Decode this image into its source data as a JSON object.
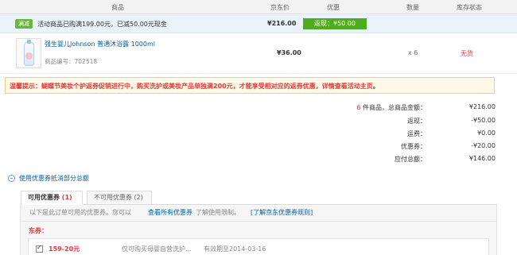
{
  "table_header": {
    "product": "商品",
    "price": "京东价",
    "discount": "优惠",
    "quantity": "数量",
    "stock": "库存状态"
  },
  "promo": {
    "tag": "满减",
    "text": "活动商品已购满199.00元，已减50.00元现金",
    "price": "¥216.00",
    "rebate": "返现：¥50.00"
  },
  "item": {
    "image_icon": "lotion-bottle-icon",
    "name": "强生婴儿Johnson 普通沐浴露 1000ml",
    "code": "商品编号：702518",
    "price": "¥36.00",
    "quantity": "x 6",
    "stock": "无货"
  },
  "warning": {
    "text": "温馨提示：蝴蝶节美妆个护返券促销进行中，购买洗护或美妆产品单独满200元，才能享受相对应的返券优惠，详情查看活动主页。"
  },
  "summary": {
    "count": "6",
    "count_suffix": "件商品，总商品金额：",
    "total_value": "¥216.00",
    "rebate_label": "返现：",
    "rebate_value": "-¥50.00",
    "shipping_label": "运费：",
    "shipping_value": "¥0.00",
    "coupon_label": "优惠券：",
    "coupon_value": "-¥20.00",
    "payable_label": "应付总额：",
    "payable_value": "¥146.00"
  },
  "coupon_section": {
    "toggle_label": "使用优惠券抵消部分总额",
    "tabs": [
      {
        "label": "可用优惠券",
        "count": "1"
      },
      {
        "label": "不可用优惠券",
        "count": "2"
      }
    ],
    "info": "以下是此订单可用的优惠券。您可以",
    "view_all_link": "查看所有优惠券",
    "view_all_suffix": "了解使用限制。",
    "rules_link": "[了解京东优惠券规则]",
    "dong_label": "东券：",
    "coupons": [
      {
        "amount": "159-20元",
        "desc": "仅可购买母婴自营洗护...",
        "expiry": "有效期至2014-03-16"
      }
    ]
  },
  "colors": {
    "accent_red": "#e4393c",
    "link_blue": "#005ea7",
    "rebate_green": "#4fad1d",
    "promo_tag_green": "#6cb43b"
  }
}
